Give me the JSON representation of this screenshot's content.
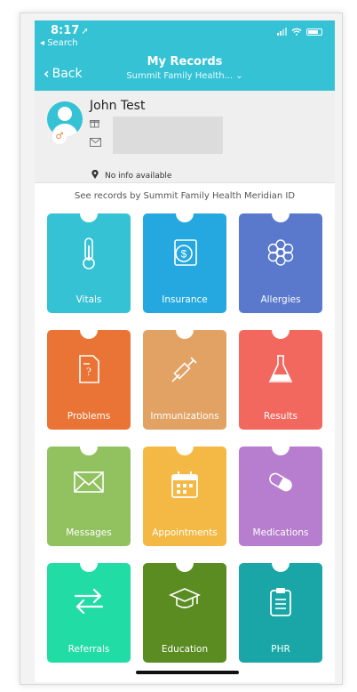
{
  "status": {
    "time": "8:17",
    "back_app": "◂ Search"
  },
  "nav": {
    "back_label": "Back",
    "title": "My Records",
    "subtitle": "Summit Family Health... ⌄"
  },
  "profile": {
    "name": "John Test",
    "location": "No info available"
  },
  "meridian_text": "See records by Summit Family Health Meridian ID",
  "tiles": [
    {
      "label": "Vitals",
      "color": "#35c2d5",
      "icon": "thermometer-icon"
    },
    {
      "label": "Insurance",
      "color": "#24a8df",
      "icon": "insurance-dollar-icon"
    },
    {
      "label": "Allergies",
      "color": "#5a78cc",
      "icon": "allergy-flower-icon"
    },
    {
      "label": "Problems",
      "color": "#ea7435",
      "icon": "problems-document-icon"
    },
    {
      "label": "Immunizations",
      "color": "#e1a264",
      "icon": "syringe-icon"
    },
    {
      "label": "Results",
      "color": "#f2685f",
      "icon": "flask-icon"
    },
    {
      "label": "Messages",
      "color": "#92c25f",
      "icon": "envelope-icon"
    },
    {
      "label": "Appointments",
      "color": "#f4b944",
      "icon": "calendar-icon"
    },
    {
      "label": "Medications",
      "color": "#b77dce",
      "icon": "pill-icon"
    },
    {
      "label": "Referrals",
      "color": "#22dca6",
      "icon": "swap-arrows-icon"
    },
    {
      "label": "Education",
      "color": "#5b8c22",
      "icon": "graduation-cap-icon"
    },
    {
      "label": "PHR",
      "color": "#1aa6a6",
      "icon": "clipboard-icon"
    }
  ]
}
